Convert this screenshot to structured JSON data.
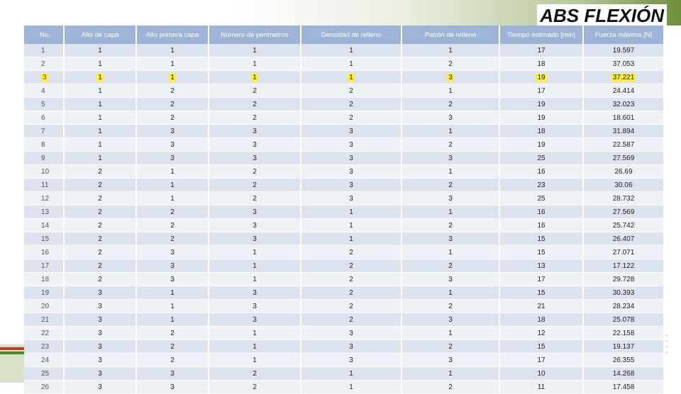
{
  "title": "ABS FLEXIÓN",
  "highlight_row": "3",
  "headers": [
    "No.",
    "Alto de capa",
    "Alto primera capa",
    "Número de perímetros",
    "Densidad de relleno",
    "Patrón de relleno",
    "Tiempo estimado [min]",
    "Fuerza máxima [N]"
  ],
  "rows": [
    [
      "1",
      "1",
      "1",
      "1",
      "1",
      "1",
      "17",
      "19.597"
    ],
    [
      "2",
      "1",
      "1",
      "1",
      "1",
      "2",
      "18",
      "37.053"
    ],
    [
      "3",
      "1",
      "1",
      "1",
      "1",
      "3",
      "19",
      "37.221"
    ],
    [
      "4",
      "1",
      "2",
      "2",
      "2",
      "1",
      "17",
      "24.414"
    ],
    [
      "5",
      "1",
      "2",
      "2",
      "2",
      "2",
      "19",
      "32.023"
    ],
    [
      "6",
      "1",
      "2",
      "2",
      "2",
      "3",
      "19",
      "18.601"
    ],
    [
      "7",
      "1",
      "3",
      "3",
      "3",
      "1",
      "18",
      "31.894"
    ],
    [
      "8",
      "1",
      "3",
      "3",
      "3",
      "2",
      "19",
      "22.587"
    ],
    [
      "9",
      "1",
      "3",
      "3",
      "3",
      "3",
      "25",
      "27.569"
    ],
    [
      "10",
      "2",
      "1",
      "2",
      "3",
      "1",
      "16",
      "26.69"
    ],
    [
      "11",
      "2",
      "1",
      "2",
      "3",
      "2",
      "23",
      "30.06"
    ],
    [
      "12",
      "2",
      "1",
      "2",
      "3",
      "3",
      "25",
      "28.732"
    ],
    [
      "13",
      "2",
      "2",
      "3",
      "1",
      "1",
      "16",
      "27.569"
    ],
    [
      "14",
      "2",
      "2",
      "3",
      "1",
      "2",
      "16",
      "25.742"
    ],
    [
      "15",
      "2",
      "2",
      "3",
      "1",
      "3",
      "15",
      "26.407"
    ],
    [
      "16",
      "2",
      "3",
      "1",
      "2",
      "1",
      "15",
      "27.071"
    ],
    [
      "17",
      "2",
      "3",
      "1",
      "2",
      "2",
      "13",
      "17.122"
    ],
    [
      "18",
      "2",
      "3",
      "1",
      "2",
      "3",
      "17",
      "29.728"
    ],
    [
      "19",
      "3",
      "1",
      "3",
      "2",
      "1",
      "15",
      "30.393"
    ],
    [
      "20",
      "3",
      "1",
      "3",
      "2",
      "2",
      "21",
      "28.234"
    ],
    [
      "21",
      "3",
      "1",
      "3",
      "2",
      "3",
      "18",
      "25.078"
    ],
    [
      "22",
      "3",
      "2",
      "1",
      "3",
      "1",
      "12",
      "22.158"
    ],
    [
      "23",
      "3",
      "2",
      "1",
      "3",
      "2",
      "15",
      "19.137"
    ],
    [
      "24",
      "3",
      "2",
      "1",
      "3",
      "3",
      "17",
      "26.355"
    ],
    [
      "25",
      "3",
      "3",
      "2",
      "1",
      "1",
      "10",
      "14.268"
    ],
    [
      "26",
      "3",
      "3",
      "2",
      "1",
      "2",
      "11",
      "17.458"
    ]
  ]
}
